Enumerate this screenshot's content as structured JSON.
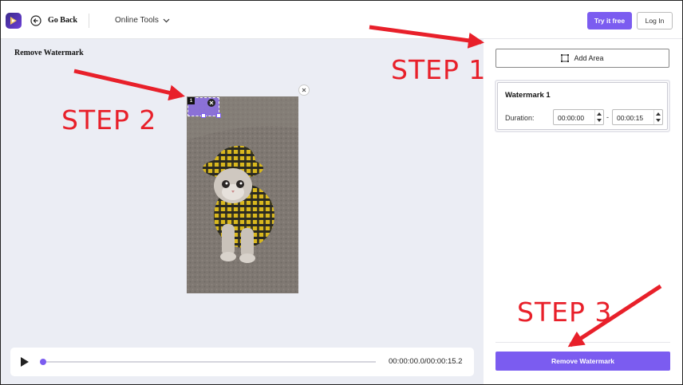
{
  "header": {
    "back_label": "Go Back",
    "tools_label": "Online Tools",
    "try_label": "Try it free",
    "login_label": "Log In"
  },
  "workspace": {
    "title": "Remove Watermark",
    "watermark_badge": "1"
  },
  "player": {
    "time": "00:00:00.0/00:00:15.2",
    "progress": 0.0
  },
  "panel": {
    "add_area_label": "Add Area",
    "card": {
      "title": "Watermark 1",
      "duration_label": "Duration:",
      "start": "00:00:00",
      "separator": "-",
      "end": "00:00:15"
    },
    "remove_label": "Remove Watermark"
  },
  "annotations": {
    "step1": "STEP 1",
    "step2": "STEP 2",
    "step3": "STEP 3"
  },
  "colors": {
    "accent": "#7b5cf0",
    "annotation": "#e8202a",
    "workspace_bg": "#ebedf4"
  },
  "icons": {
    "logo": "app-logo-icon",
    "back": "back-arrow-icon",
    "chevron": "chevron-down-icon",
    "play": "play-icon",
    "area": "select-area-icon",
    "close": "close-icon"
  }
}
